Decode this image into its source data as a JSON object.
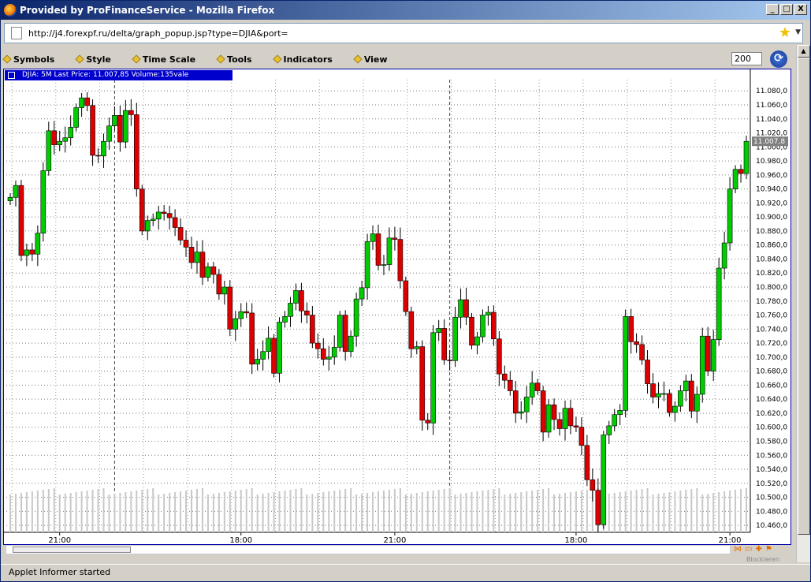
{
  "window": {
    "title": "Provided by ProFinanceService - Mozilla Firefox",
    "minimize": "_",
    "maximize": "□",
    "close": "X"
  },
  "address": {
    "url": "http://j4.forexpf.ru/delta/graph_popup.jsp?type=DJIA&port="
  },
  "menu": {
    "items": [
      "Symbols",
      "Style",
      "Time Scale",
      "Tools",
      "Indicators",
      "View"
    ]
  },
  "toolbar": {
    "zoom_value": "200",
    "refresh_icon": "refresh-icon"
  },
  "chart_data": {
    "type": "candlestick",
    "legend_text": "DJIA: 5M Last Price: 11.007,85 Volume:135vale",
    "last_price_label": "11.007,8",
    "y_ticks": [
      "11.080,0",
      "11.060,0",
      "11.040,0",
      "11.020,0",
      "11.000,0",
      "10.980,0",
      "10.960,0",
      "10.940,0",
      "10.920,0",
      "10.900,0",
      "10.880,0",
      "10.860,0",
      "10.840,0",
      "10.820,0",
      "10.800,0",
      "10.780,0",
      "10.760,0",
      "10.740,0",
      "10.720,0",
      "10.700,0",
      "10.680,0",
      "10.660,0",
      "10.640,0",
      "10.620,0",
      "10.600,0",
      "10.580,0",
      "10.560,0",
      "10.540,0",
      "10.520,0",
      "10.500,0",
      "10.480,0",
      "10.460,0"
    ],
    "y_tick_values": [
      11080,
      11060,
      11040,
      11020,
      11000,
      10980,
      10960,
      10940,
      10920,
      10900,
      10880,
      10860,
      10840,
      10820,
      10800,
      10780,
      10760,
      10740,
      10720,
      10700,
      10680,
      10660,
      10640,
      10620,
      10600,
      10580,
      10560,
      10540,
      10520,
      10500,
      10480,
      10460
    ],
    "ylim": [
      10450,
      11096
    ],
    "x_ticks": [
      {
        "label": "21:00",
        "bar": 9
      },
      {
        "label": "18:00",
        "bar": 42
      },
      {
        "label": "21:00",
        "bar": 70
      },
      {
        "label": "18:00",
        "bar": 103
      },
      {
        "label": "21:00",
        "bar": 131
      }
    ],
    "session_breaks": [
      19,
      80
    ],
    "up_color": "#00cc00",
    "down_color": "#dd0000",
    "closes": [
      10928,
      10945,
      10845,
      10853,
      10847,
      10877,
      10966,
      11023,
      11003,
      11008,
      11013,
      11028,
      11056,
      11070,
      11059,
      10988,
      10987,
      11008,
      11030,
      11045,
      11007,
      11052,
      11046,
      10940,
      10880,
      10895,
      10897,
      10907,
      10905,
      10899,
      10885,
      10867,
      10857,
      10835,
      10850,
      10814,
      10829,
      10818,
      10790,
      10800,
      10740,
      10755,
      10765,
      10763,
      10690,
      10697,
      10708,
      10727,
      10677,
      10750,
      10758,
      10777,
      10795,
      10766,
      10760,
      10720,
      10712,
      10697,
      10700,
      10714,
      10760,
      10708,
      10730,
      10783,
      10799,
      10865,
      10876,
      10831,
      10832,
      10870,
      10868,
      10809,
      10765,
      10712,
      10715,
      10610,
      10606,
      10735,
      10741,
      10696,
      10695,
      10757,
      10782,
      10757,
      10717,
      10729,
      10760,
      10764,
      10726,
      10676,
      10667,
      10652,
      10620,
      10622,
      10643,
      10663,
      10652,
      10593,
      10632,
      10611,
      10598,
      10627,
      10602,
      10600,
      10574,
      10525,
      10510,
      10461,
      10589,
      10602,
      10618,
      10624,
      10758,
      10722,
      10718,
      10696,
      10662,
      10643,
      10648,
      10648,
      10621,
      10630,
      10652,
      10666,
      10623,
      10647,
      10730,
      10680,
      10725,
      10827,
      10863,
      10940,
      10968,
      10962,
      11008
    ]
  },
  "status": {
    "text": "Applet Informer started",
    "blocker": "Blockieren"
  },
  "colors": {
    "title_blue": "#0a246a",
    "chart_border": "#0000aa",
    "up": "#00cc00",
    "down": "#dd0000"
  }
}
